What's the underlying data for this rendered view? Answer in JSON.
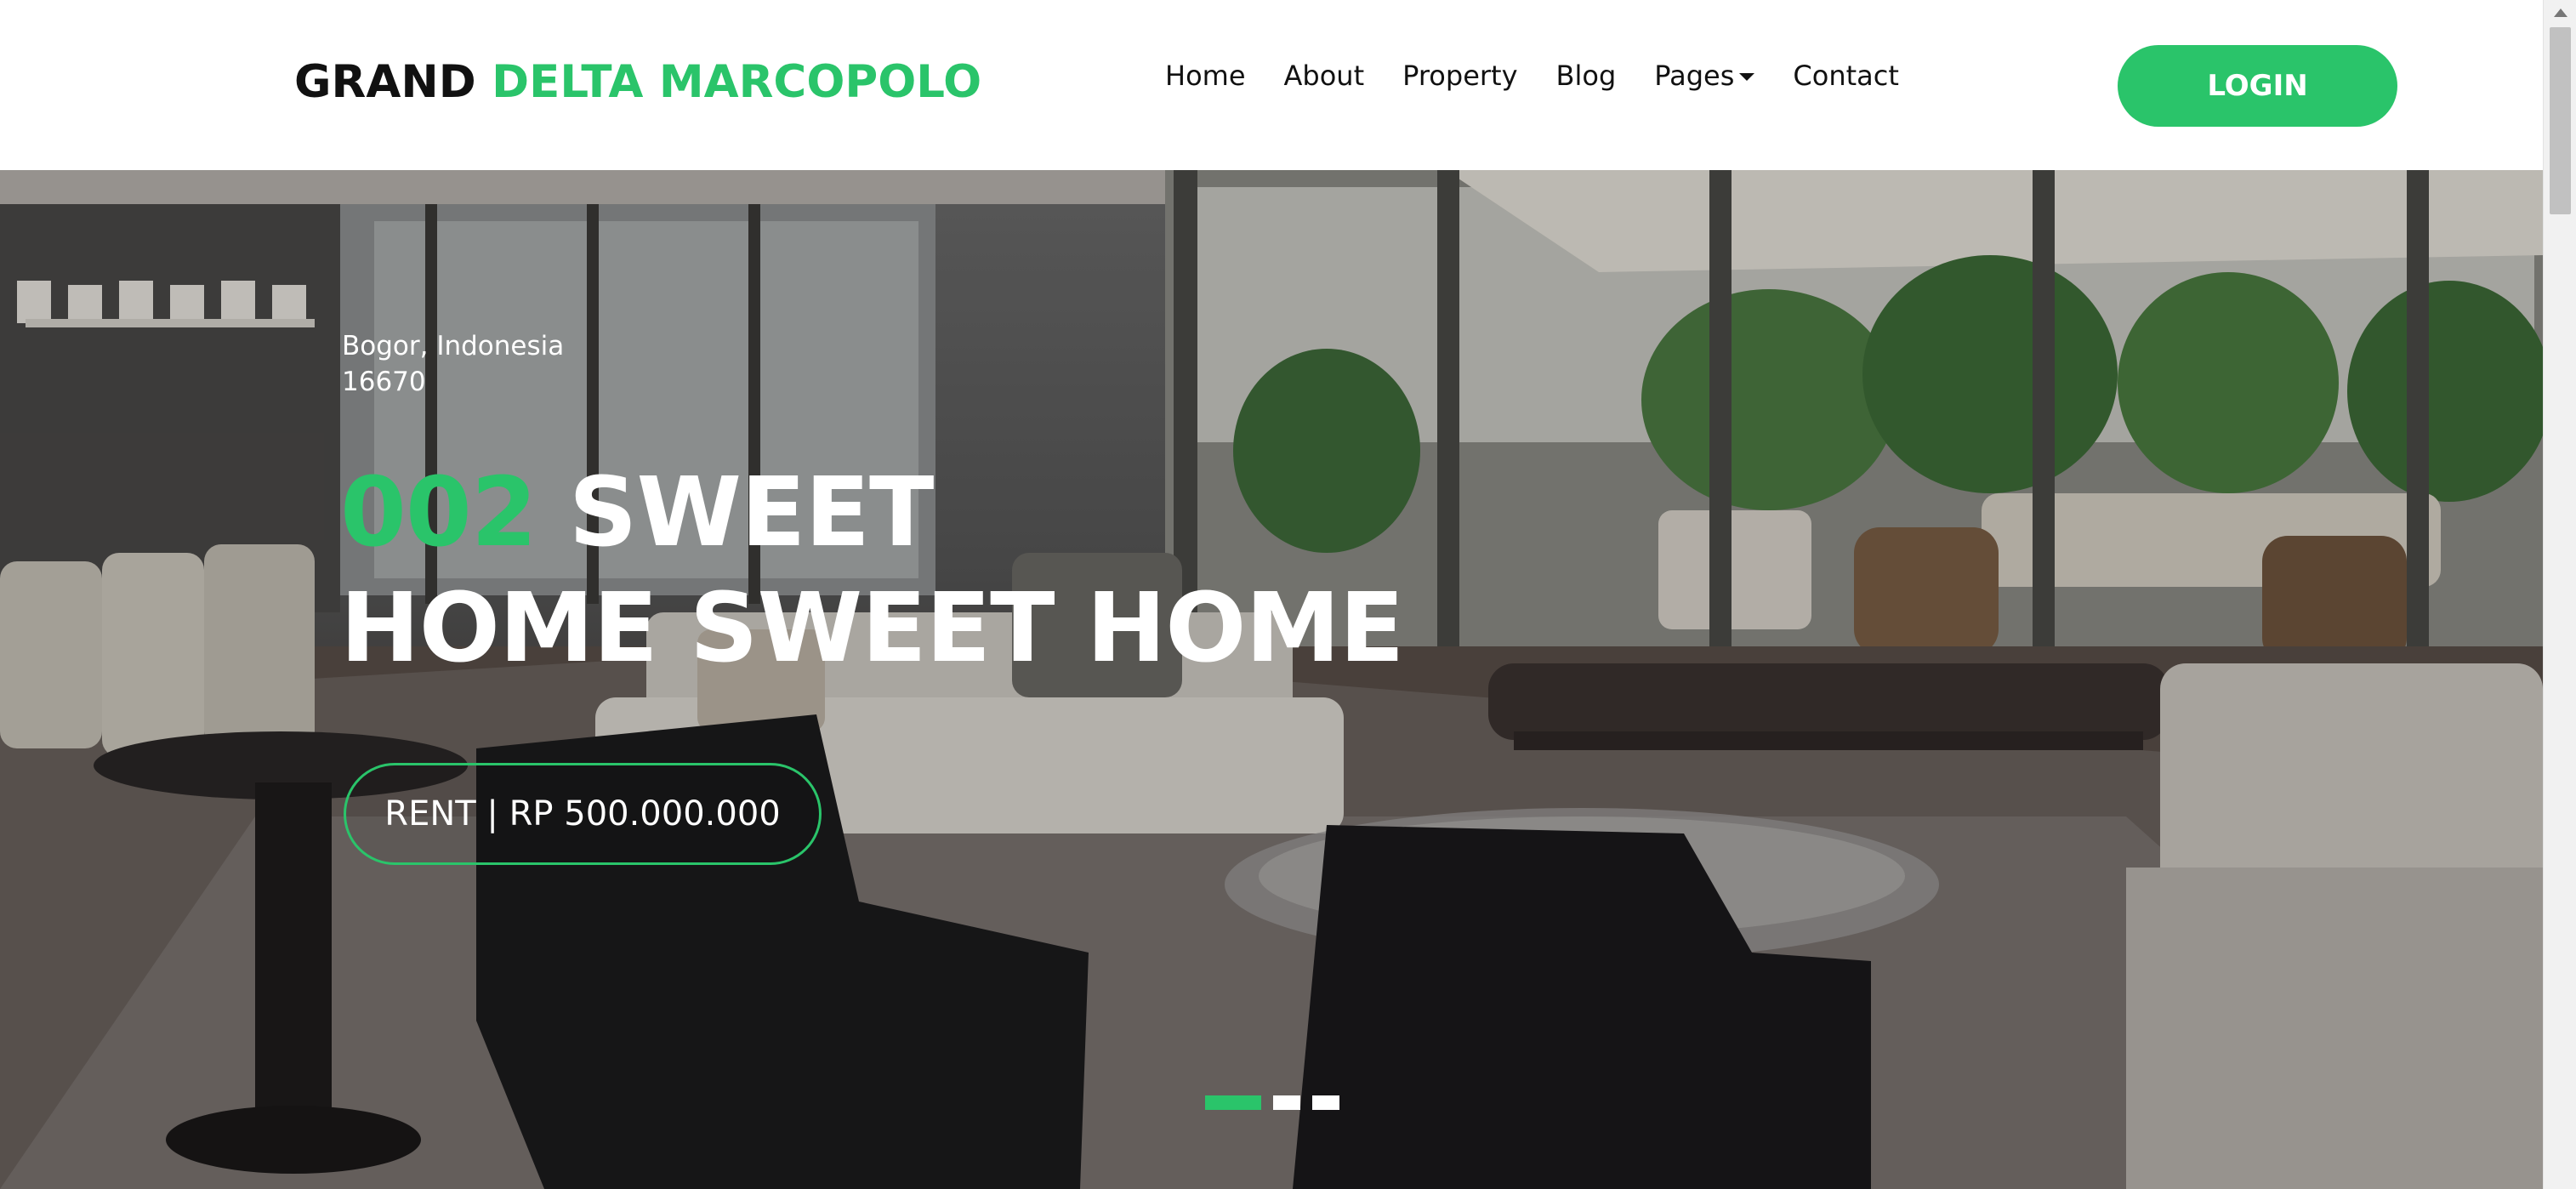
{
  "header": {
    "logo_part1": "GRAND ",
    "logo_part2": "DELTA MARCOPOLO",
    "nav": {
      "home": "Home",
      "about": "About",
      "property": "Property",
      "blog": "Blog",
      "pages": "Pages",
      "contact": "Contact"
    },
    "login": "LOGIN"
  },
  "hero": {
    "location_line1": "Bogor, Indonesia",
    "location_line2": "16670",
    "headline_number": "002",
    "headline_rest": " SWEET",
    "headline_line2": "HOME SWEET HOME",
    "price": "RENT | RP 500.000.000",
    "slides_count": 3,
    "active_slide": 1
  },
  "colors": {
    "accent": "#2ac46a",
    "text_dark": "#111111",
    "text_light": "#ffffff"
  },
  "icons": [
    "caret-down-icon",
    "scroll-up-arrow-icon"
  ]
}
